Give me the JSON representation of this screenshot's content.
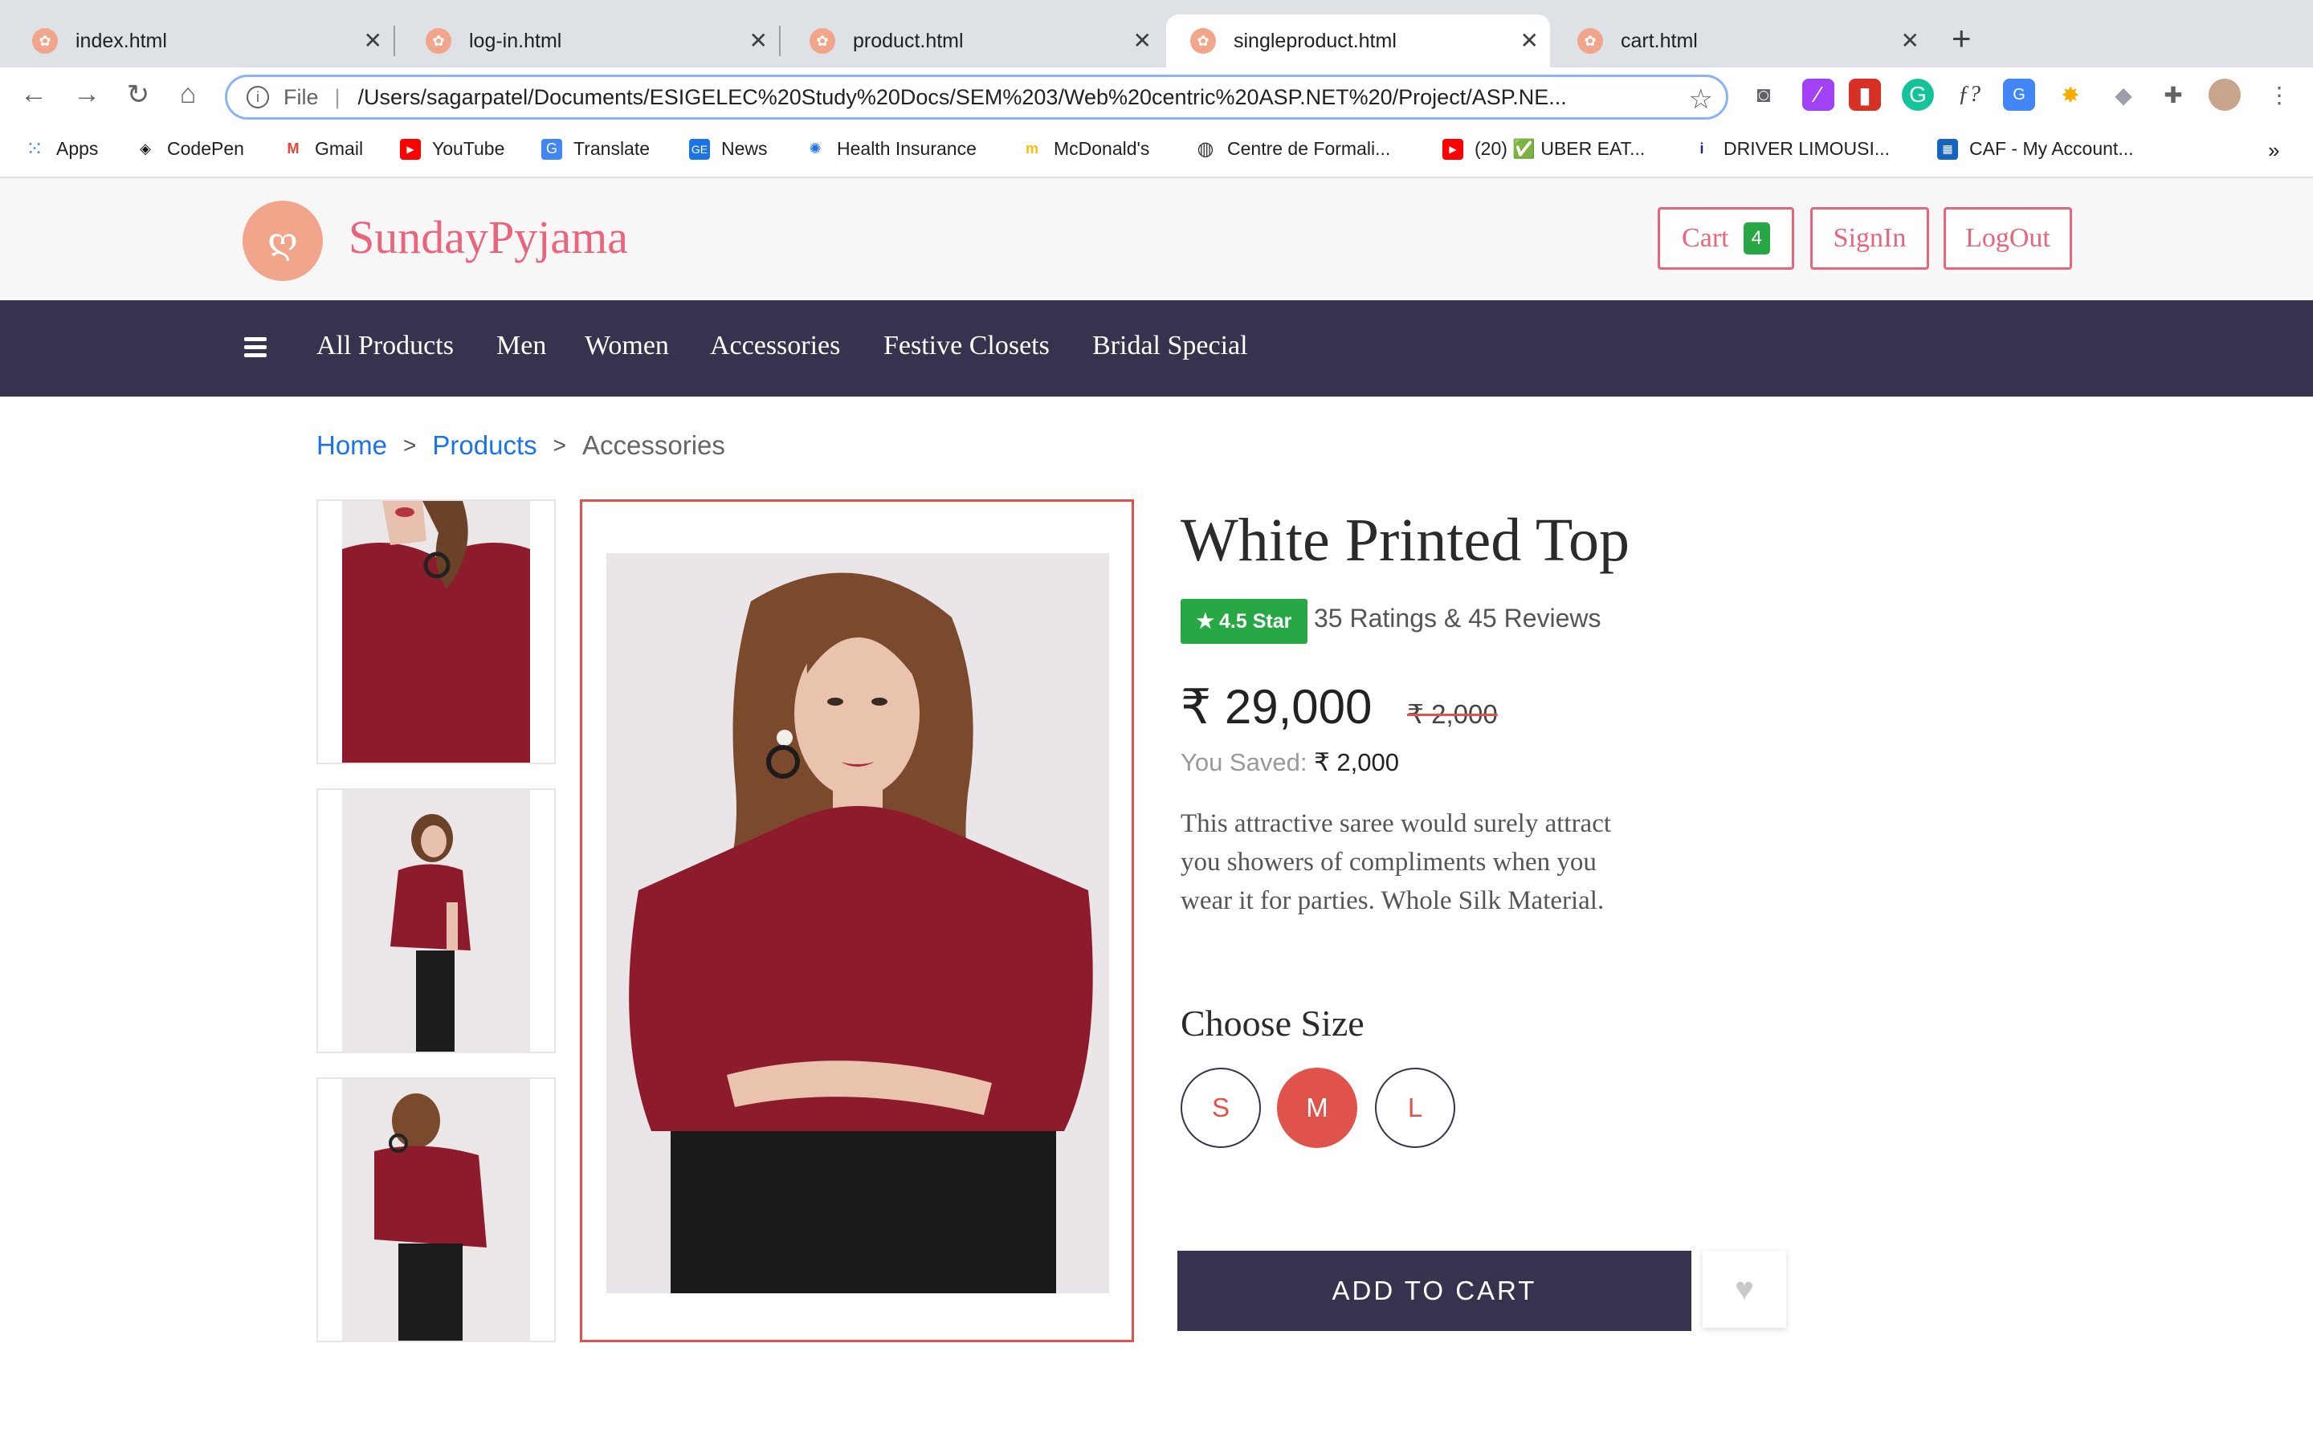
{
  "browser": {
    "tabs": [
      {
        "label": "index.html"
      },
      {
        "label": "log-in.html"
      },
      {
        "label": "product.html"
      },
      {
        "label": "singleproduct.html"
      },
      {
        "label": "cart.html"
      }
    ],
    "url_scheme": "File",
    "url": "/Users/sagarpatel/Documents/ESIGELEC%20Study%20Docs/SEM%203/Web%20centric%20ASP.NET%20/Project/ASP.NE...",
    "bookmarks": [
      {
        "label": "Apps",
        "icon": "apps-grid-icon"
      },
      {
        "label": "CodePen",
        "icon": "codepen-icon"
      },
      {
        "label": "Gmail",
        "icon": "gmail-icon"
      },
      {
        "label": "YouTube",
        "icon": "youtube-icon"
      },
      {
        "label": "Translate",
        "icon": "translate-icon"
      },
      {
        "label": "News",
        "icon": "news-icon"
      },
      {
        "label": "Health Insurance",
        "icon": "health-icon"
      },
      {
        "label": "McDonald's",
        "icon": "mcdonalds-icon"
      },
      {
        "label": "Centre de Formali...",
        "icon": "globe-icon"
      },
      {
        "label": "(20) ✅ UBER EAT...",
        "icon": "youtube-icon"
      },
      {
        "label": "DRIVER LIMOUSI...",
        "icon": "info-icon"
      },
      {
        "label": "CAF - My Account...",
        "icon": "caf-icon"
      }
    ],
    "more_bookmarks": "»"
  },
  "site": {
    "brand": "SundayPyjama",
    "header_buttons": {
      "cart_label": "Cart",
      "cart_count": "4",
      "signin": "SignIn",
      "logout": "LogOut"
    },
    "nav": [
      "All Products",
      "Men",
      "Women",
      "Accessories",
      "Festive Closets",
      "Bridal Special"
    ]
  },
  "breadcrumb": {
    "home": "Home",
    "products": "Products",
    "current": "Accessories",
    "separator": ">"
  },
  "product": {
    "title": "White Printed Top",
    "rating_badge": "4.5 Star",
    "ratings_text": "35 Ratings & 45 Reviews",
    "price": "₹ 29,000",
    "old_price": "₹ 2,000",
    "saved_label": "You Saved:",
    "saved_value": "₹ 2,000",
    "description": "This attractive saree would surely attract you showers of compliments when you wear it for parties. Whole Silk Material.",
    "choose_size_label": "Choose Size",
    "sizes": [
      "S",
      "M",
      "L"
    ],
    "selected_size": "M",
    "add_to_cart": "ADD TO CART"
  },
  "colors": {
    "brand_pink": "#e9657c",
    "nav_bg": "#37334f",
    "accent_red": "#e0534a",
    "rating_green": "#28a745",
    "link_blue": "#1a73e8"
  }
}
